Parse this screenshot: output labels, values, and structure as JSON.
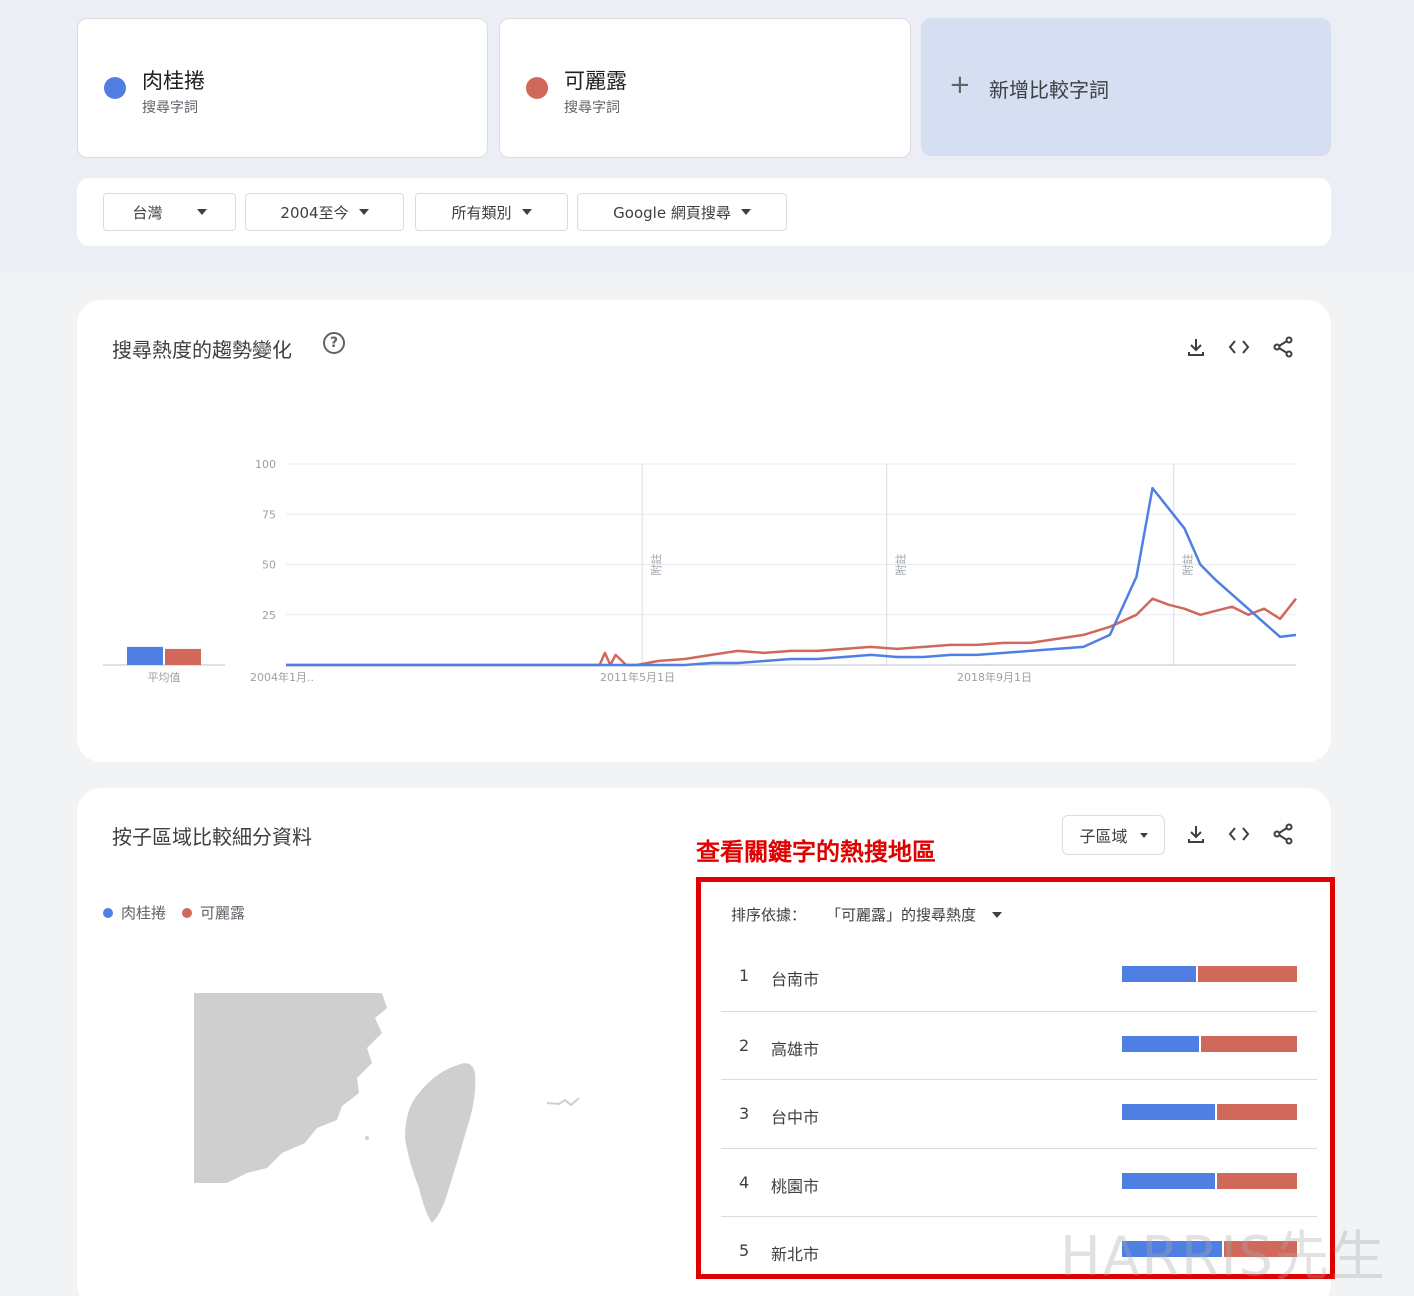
{
  "terms": [
    {
      "name": "肉桂捲",
      "subtitle": "搜尋字詞",
      "color": "#4f7fe3"
    },
    {
      "name": "可麗露",
      "subtitle": "搜尋字詞",
      "color": "#d0695c"
    }
  ],
  "add_term": {
    "icon": "plus-icon",
    "label": "新增比較字詞"
  },
  "filters": {
    "region": "台灣",
    "time": "2004至今",
    "category": "所有類別",
    "search_type": "Google 網頁搜尋"
  },
  "trend_panel": {
    "title": "搜尋熱度的趨勢變化",
    "help": "?",
    "avg_label": "平均值",
    "note_label": "附註"
  },
  "chart_data": {
    "type": "line",
    "y_ticks": [
      "100",
      "75",
      "50",
      "25"
    ],
    "ylim": [
      0,
      100
    ],
    "x_tick_labels": [
      "2004年1月..",
      "2011年5月1日",
      "2018年9月1日"
    ],
    "xlim": [
      2004.0,
      2023.0
    ],
    "grid": true,
    "notes_at": [
      2010.7,
      2015.3,
      2020.7
    ],
    "averages": {
      "肉桂捲": 9,
      "可麗露": 8
    },
    "series": [
      {
        "name": "肉桂捲",
        "color": "#4f7fe3",
        "x": [
          2004.0,
          2011.0,
          2011.5,
          2012.0,
          2012.5,
          2013.0,
          2013.5,
          2014.0,
          2014.5,
          2015.0,
          2015.5,
          2016.0,
          2016.5,
          2017.0,
          2017.5,
          2018.0,
          2018.5,
          2019.0,
          2019.5,
          2020.0,
          2020.3,
          2020.6,
          2020.9,
          2021.2,
          2021.5,
          2021.8,
          2022.1,
          2022.4,
          2022.7,
          2023.0
        ],
        "y": [
          0,
          0,
          0,
          1,
          1,
          2,
          3,
          3,
          4,
          5,
          4,
          4,
          5,
          5,
          6,
          7,
          8,
          9,
          15,
          44,
          88,
          78,
          68,
          50,
          42,
          35,
          28,
          21,
          14,
          15
        ]
      },
      {
        "name": "可麗露",
        "color": "#d0695c",
        "x": [
          2004.0,
          2009.9,
          2010.0,
          2010.1,
          2010.2,
          2010.4,
          2010.6,
          2011.0,
          2011.5,
          2012.0,
          2012.5,
          2013.0,
          2013.5,
          2014.0,
          2014.5,
          2015.0,
          2015.5,
          2016.0,
          2016.5,
          2017.0,
          2017.5,
          2018.0,
          2018.5,
          2019.0,
          2019.5,
          2020.0,
          2020.3,
          2020.6,
          2020.9,
          2021.2,
          2021.5,
          2021.8,
          2022.1,
          2022.4,
          2022.7,
          2023.0
        ],
        "y": [
          0,
          0,
          6,
          0,
          5,
          0,
          0,
          2,
          3,
          5,
          7,
          6,
          7,
          7,
          8,
          9,
          8,
          9,
          10,
          10,
          11,
          11,
          13,
          15,
          19,
          25,
          33,
          30,
          28,
          25,
          27,
          29,
          25,
          28,
          23,
          33
        ]
      }
    ]
  },
  "region_panel": {
    "title": "按子區域比較細分資料",
    "dropdown": "子區域",
    "annotation": "查看關鍵字的熱搜地區",
    "sort_label": "排序依據：",
    "sort_value": "「可麗露」的搜尋熱度",
    "regions": [
      {
        "rank": "1",
        "name": "台南市",
        "blue": 0.42
      },
      {
        "rank": "2",
        "name": "高雄市",
        "blue": 0.44
      },
      {
        "rank": "3",
        "name": "台中市",
        "blue": 0.53
      },
      {
        "rank": "4",
        "name": "桃園市",
        "blue": 0.53
      },
      {
        "rank": "5",
        "name": "新北市",
        "blue": 0.57
      }
    ]
  },
  "watermark": "HARRIS先生"
}
